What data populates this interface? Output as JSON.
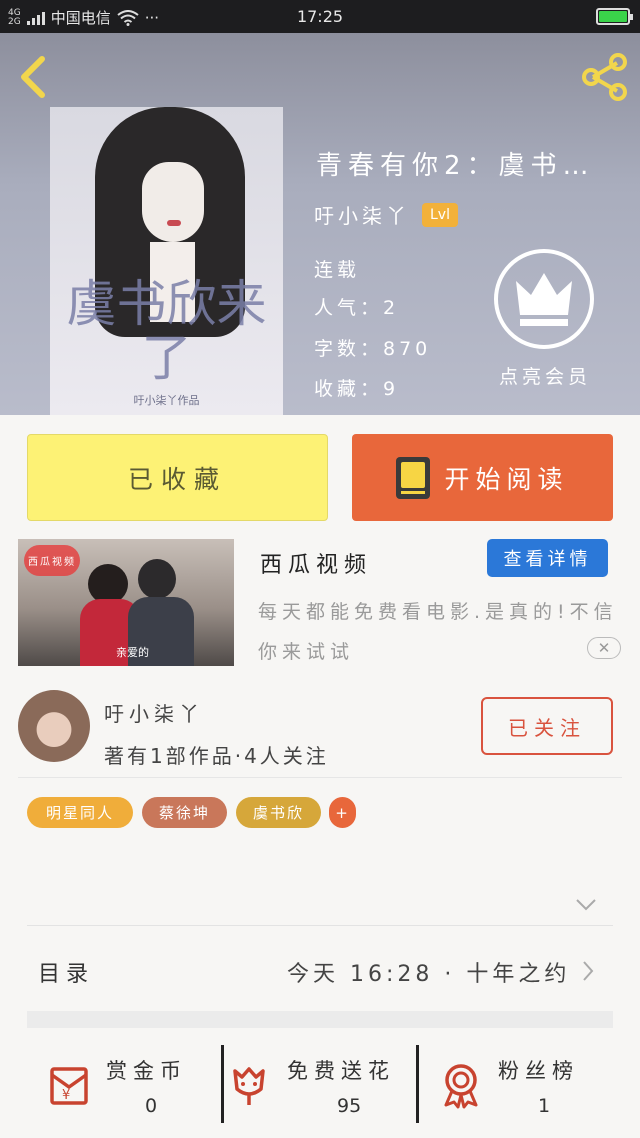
{
  "status_bar": {
    "network": "4G\n2G",
    "carrier": "中国电信",
    "more": "···",
    "time": "17:25"
  },
  "book": {
    "title": "青春有你2：虞书…",
    "author": "吁小柒丫",
    "level": "Lvl",
    "status": "连载",
    "popularity": "人气：2",
    "word_count": "字数：870",
    "favorites": "收藏：9",
    "vip_label": "点亮会员",
    "cover_title": "虞书欣来了",
    "cover_author": "吁小柒丫作品"
  },
  "actions": {
    "favorited_label": "已收藏",
    "read_label": "开始阅读"
  },
  "ad": {
    "video_tag": "西瓜视频",
    "caption": "亲爱的",
    "name": "西瓜视频",
    "detail_label": "查看详情",
    "description": "每天都能免费看电影.是真的!不信你来试试",
    "close_label": "✕"
  },
  "author_card": {
    "name": "吁小柒丫",
    "stats": "著有1部作品·4人关注",
    "follow_label": "已关注"
  },
  "tags": [
    {
      "label": "明星同人",
      "color": "#f0ad3a"
    },
    {
      "label": "蔡徐坤",
      "color": "#c9775a"
    },
    {
      "label": "虞书欣",
      "color": "#d6a73a"
    },
    {
      "label": "+",
      "color": "#e8673b"
    }
  ],
  "toc": {
    "label": "目录",
    "latest": "今天 16:28 · 十年之约"
  },
  "bottom_bar": {
    "coins_label": "赏金币",
    "coins_value": "0",
    "flowers_label": "免费送花",
    "flowers_value": "95",
    "fans_label": "粉丝榜",
    "fans_value": "1"
  },
  "colors": {
    "accent_orange": "#e8673b",
    "fav_yellow": "#fdf275",
    "follow_red": "#d9533e",
    "detail_blue": "#2b78d8",
    "icon_red": "#c8432f"
  }
}
